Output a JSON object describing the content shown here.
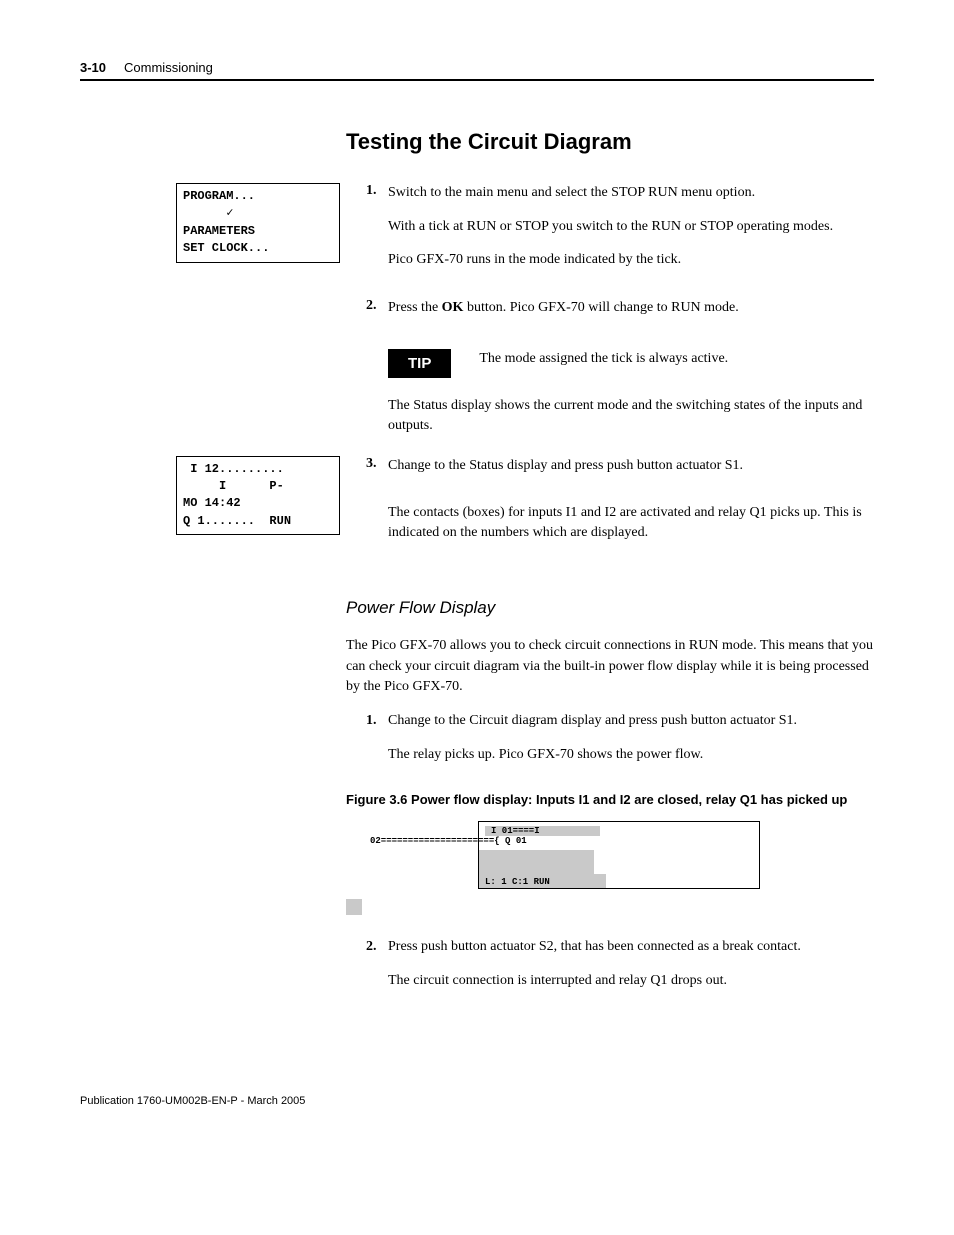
{
  "header": {
    "page_num": "3-10",
    "chapter": "Commissioning"
  },
  "section_title": "Testing the Circuit Diagram",
  "screen1": {
    "l1": "PROGRAM...",
    "l2": "      ✓",
    "l3": "PARAMETERS",
    "l4": "SET CLOCK..."
  },
  "step1": {
    "num": "1.",
    "text": "Switch to the main menu and select the STOP RUN menu option.",
    "p2": "With a tick at RUN or STOP you switch to the RUN or STOP operating modes.",
    "p3": "Pico GFX-70 runs in the mode indicated by the tick."
  },
  "step2": {
    "num": "2.",
    "text_a": "Press the ",
    "text_b": "OK",
    "text_c": " button. Pico GFX-70 will change to RUN mode."
  },
  "tip": {
    "label": "TIP",
    "text": "The mode assigned the tick is always active."
  },
  "status_para": "The Status display shows the current mode and the switching states of the inputs and outputs.",
  "screen2": {
    "l1": " I 12.........",
    "l2": "     I      P-",
    "l3": "MO 14:42",
    "l4": "Q 1.......  RUN"
  },
  "step3": {
    "num": "3.",
    "text": "Change to the Status display and press push button actuator S1.",
    "p2": "The contacts (boxes) for inputs I1 and I2 are activated and relay Q1 picks up. This is indicated on the numbers which are displayed."
  },
  "subhead": "Power Flow Display",
  "pf_para": "The Pico GFX-70 allows you to check circuit connections in RUN mode. This means that you can check your circuit diagram via the built-in power flow display while it is being processed by the Pico GFX-70.",
  "pf_step1": {
    "num": "1.",
    "text": "Change to the Circuit diagram display and press push button actuator S1.",
    "p2": "The relay picks up. Pico GFX-70 shows the power flow."
  },
  "fig_caption": "Figure  3.6 Power flow display: Inputs I1 and I2 are closed, relay Q1 has picked up",
  "fig": {
    "line1": "I 01====I 02====================={ Q 01",
    "line2": "L: 1 C:1 RUN"
  },
  "pf_step2": {
    "num": "2.",
    "text": "Press push button actuator S2, that has been connected as a break contact.",
    "p2": "The circuit connection is interrupted and relay Q1 drops out."
  },
  "footer": "Publication 1760-UM002B-EN-P - March 2005"
}
